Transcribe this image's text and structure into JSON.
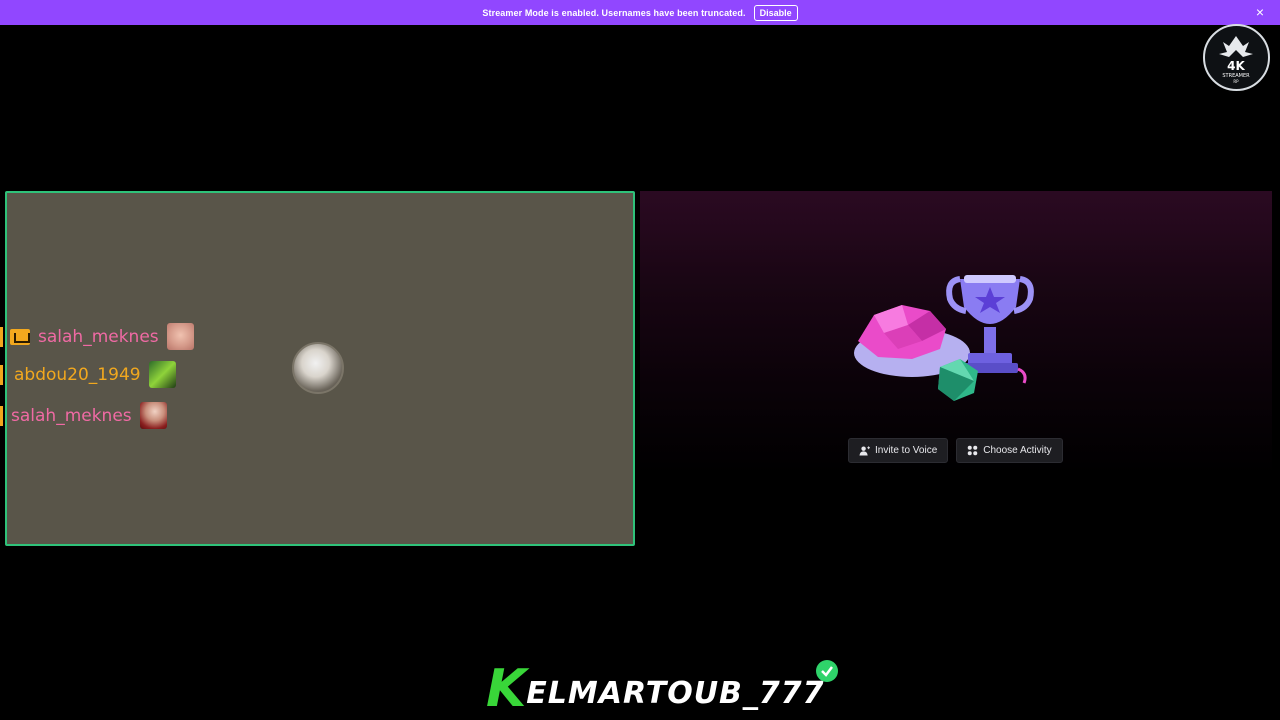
{
  "banner": {
    "message": "Streamer Mode is enabled. Usernames have been truncated.",
    "disable_label": "Disable",
    "close_glyph": "×",
    "color": "#9147ff"
  },
  "logo": {
    "text_main": "4K",
    "text_sub": "STREAMER",
    "text_tiny": "RP"
  },
  "voice_panel": {
    "border_color": "#2fc27a",
    "users": [
      {
        "name": "salah_meknes",
        "color": "#f06aa4",
        "has_crown": true
      },
      {
        "name": "abdou20_1949",
        "color": "#f2a81e",
        "has_crown": false
      },
      {
        "name": "salah_meknes",
        "color": "#f06aa4",
        "has_crown": false
      }
    ]
  },
  "activity_panel": {
    "invite_label": "Invite to Voice",
    "choose_label": "Choose Activity",
    "invite_icon": "add-user-icon",
    "choose_icon": "grid-icon"
  },
  "signature": {
    "initial": "K",
    "rest": "ELMARTOUB_777",
    "accent": "#39d639"
  }
}
